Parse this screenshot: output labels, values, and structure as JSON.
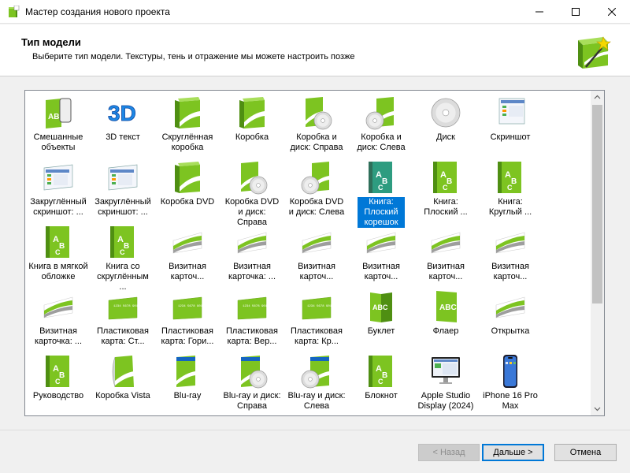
{
  "window": {
    "title": "Мастер создания нового проекта"
  },
  "header": {
    "title": "Тип модели",
    "subtitle": "Выберите тип модели. Текстуры, тень и отражение мы можете настроить позже"
  },
  "items": [
    {
      "label": "Смешанные объекты",
      "icon": "mixed-objects-icon"
    },
    {
      "label": "3D текст",
      "icon": "3d-text-icon"
    },
    {
      "label": "Скруглённая коробка",
      "icon": "rounded-box-icon"
    },
    {
      "label": "Коробка",
      "icon": "box-icon"
    },
    {
      "label": "Коробка и диск: Справа",
      "icon": "box-disc-right-icon"
    },
    {
      "label": "Коробка и диск: Слева",
      "icon": "box-disc-left-icon"
    },
    {
      "label": "Диск",
      "icon": "disc-icon"
    },
    {
      "label": "Скриншот",
      "icon": "screenshot-icon"
    },
    {
      "label": "Закруглённый скриншот: ...",
      "icon": "curved-screenshot-icon"
    },
    {
      "label": "Закруглённый скриншот: ...",
      "icon": "curved-screenshot-icon"
    },
    {
      "label": "Коробка DVD",
      "icon": "dvd-box-icon"
    },
    {
      "label": "Коробка DVD и диск: Справа",
      "icon": "dvd-box-disc-right-icon"
    },
    {
      "label": "Коробка DVD и диск: Слева",
      "icon": "dvd-box-disc-left-icon"
    },
    {
      "label": "Книга: Плоский корешок",
      "icon": "book-flat-spine-icon"
    },
    {
      "label": "Книга: Плоский ...",
      "icon": "book-flat-icon"
    },
    {
      "label": "Книга: Круглый ...",
      "icon": "book-round-icon"
    },
    {
      "label": "Книга в мягкой обложке",
      "icon": "paperback-book-icon"
    },
    {
      "label": "Книга со скруглённым ...",
      "icon": "rounded-book-icon"
    },
    {
      "label": "Визитная карточ...",
      "icon": "business-card-icon"
    },
    {
      "label": "Визитная карточка: ...",
      "icon": "business-card-icon"
    },
    {
      "label": "Визитная карточ...",
      "icon": "business-card-icon"
    },
    {
      "label": "Визитная карточ...",
      "icon": "business-card-icon"
    },
    {
      "label": "Визитная карточ...",
      "icon": "business-card-icon"
    },
    {
      "label": "Визитная карточ...",
      "icon": "business-card-icon"
    },
    {
      "label": "Визитная карточка: ...",
      "icon": "business-card-icon"
    },
    {
      "label": "Пластиковая карта: Ст...",
      "icon": "plastic-card-icon"
    },
    {
      "label": "Пластиковая карта: Гори...",
      "icon": "plastic-card-icon"
    },
    {
      "label": "Пластиковая карта: Вер...",
      "icon": "plastic-card-icon"
    },
    {
      "label": "Пластиковая карта: Кр...",
      "icon": "plastic-card-icon"
    },
    {
      "label": "Буклет",
      "icon": "booklet-icon"
    },
    {
      "label": "Флаер",
      "icon": "flyer-icon"
    },
    {
      "label": "Открытка",
      "icon": "postcard-icon"
    },
    {
      "label": "Руководство",
      "icon": "manual-icon"
    },
    {
      "label": "Коробка Vista",
      "icon": "vista-box-icon"
    },
    {
      "label": "Blu-ray",
      "icon": "bluray-icon"
    },
    {
      "label": "Blu-ray и диск: Справа",
      "icon": "bluray-disc-right-icon"
    },
    {
      "label": "Blu-ray и диск: Слева",
      "icon": "bluray-disc-left-icon"
    },
    {
      "label": "Блокнот",
      "icon": "notebook-icon"
    },
    {
      "label": "Apple Studio Display (2024)",
      "icon": "monitor-icon"
    },
    {
      "label": "iPhone 16 Pro Max",
      "icon": "phone-icon"
    }
  ],
  "selected_index": 13,
  "buttons": {
    "back": "< Назад",
    "next": "Дальше >",
    "cancel": "Отмена"
  },
  "colors": {
    "accent": "#0078d7",
    "green": "#7dc421",
    "dark_green": "#4f8f12"
  }
}
